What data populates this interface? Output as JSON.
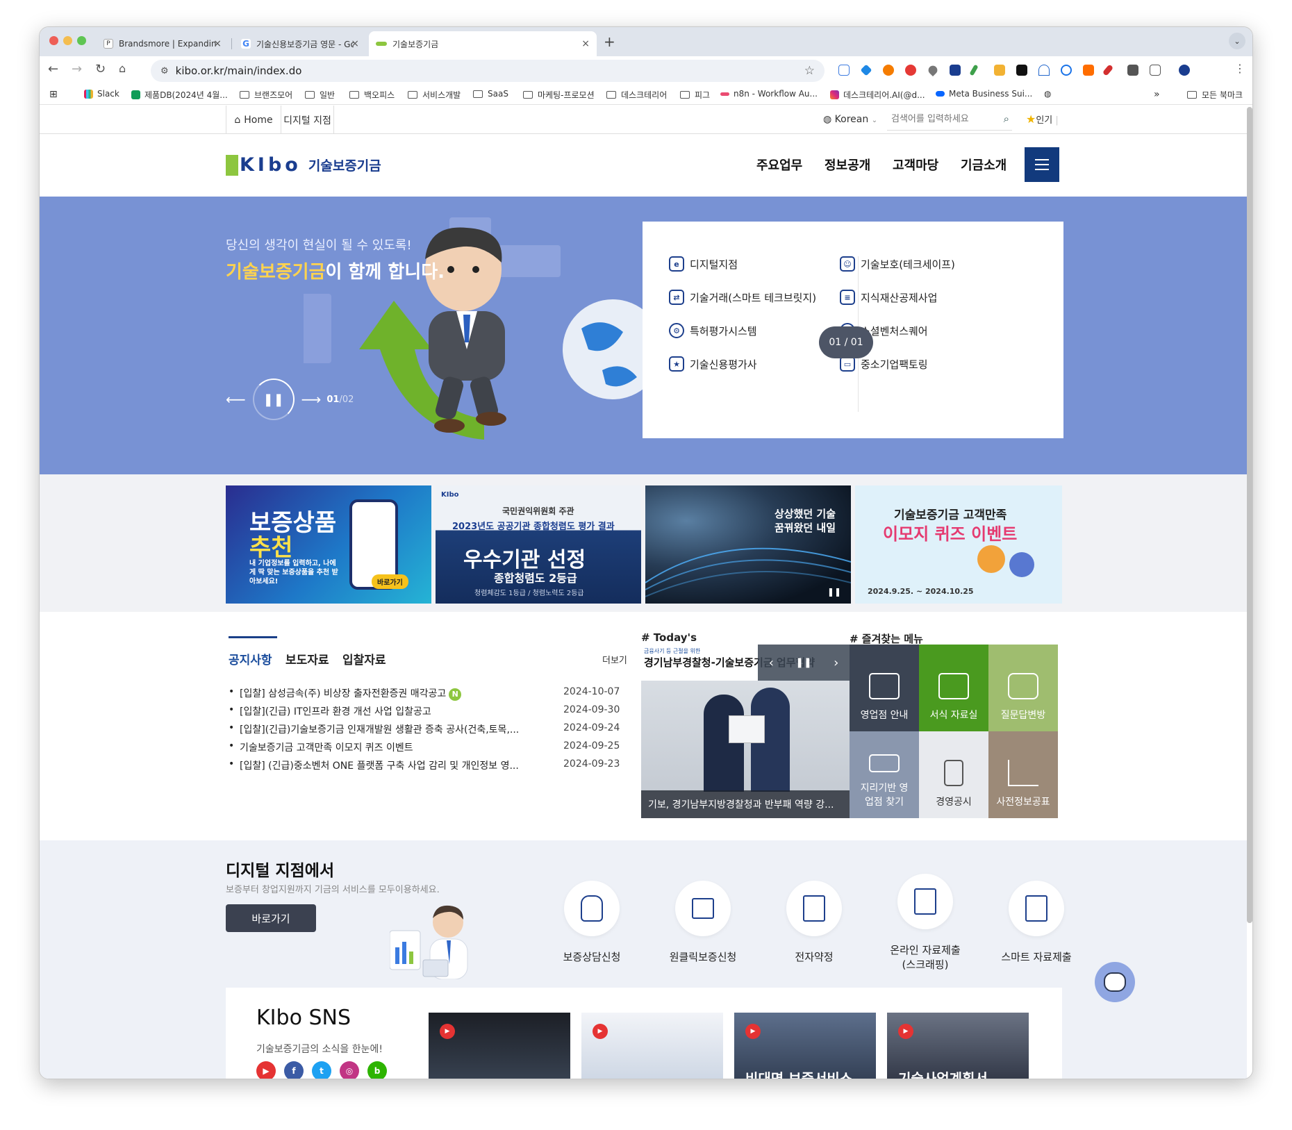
{
  "browser": {
    "tabs": [
      {
        "title": "Brandsmore | Expanding Lifes",
        "favicon": "P"
      },
      {
        "title": "기술신용보증기금 영문 - Google",
        "favicon": "G"
      },
      {
        "title": "기술보증기금",
        "favicon": ""
      }
    ],
    "url": "kibo.or.kr/main/index.do",
    "bookmarks": [
      "Slack",
      "제품DB(2024년 4월...",
      "브랜즈모어",
      "일반",
      "백오피스",
      "서비스개발",
      "SaaS",
      "마케팅-프로모션",
      "데스크테리어",
      "피그",
      "n8n - Workflow Au...",
      "데스크테리어.AI(@d...",
      "Meta Business Sui..."
    ],
    "bookmarks_more": "»",
    "all_bookmarks": "모든 북마크"
  },
  "utility": {
    "home": "Home",
    "digital": "디지털 지점",
    "language": "Korean",
    "search_placeholder": "검색어를 입력하세요",
    "popular": "인기"
  },
  "header": {
    "logo_text": "KIbo",
    "org_name": "기술보증기금",
    "nav": [
      "주요업무",
      "정보공개",
      "고객마당",
      "기금소개"
    ]
  },
  "hero": {
    "subtitle": "당신의 생각이 현실이 될 수 있도록!",
    "title_highlight": "기술보증기금",
    "title_rest": "이 함께 합니다.",
    "slide_current": "01",
    "slide_total": "/02",
    "services_left": [
      "디지털지점",
      "기술거래(스마트 테크브릿지)",
      "특허평가시스템",
      "기술신용평가사"
    ],
    "services_right": [
      "기술보호(테크세이프)",
      "지식재산공제사업",
      "소셜벤처스퀘어",
      "중소기업팩토링"
    ],
    "panel_pager": "01 / 01"
  },
  "banners": [
    {
      "title": "보증상품",
      "title2": "추천",
      "desc": "내 기업정보를 입력하고, 나에게 딱 맞는 보증상품을 추천 받아보세요!",
      "cta": "바로가기"
    },
    {
      "org": "국민권익위원회 주관",
      "line1": "2023년도 공공기관 종합청렴도 평가 결과",
      "title": "우수기관 선정",
      "line2": "종합청렴도 2등급",
      "line3": "청렴체감도 1등급 / 청렴노력도 2등급"
    },
    {
      "line1": "상상했던 기술",
      "line2": "꿈꿔왔던 내일"
    },
    {
      "title": "기술보증기금 고객만족",
      "title2": "이모지 퀴즈 이벤트",
      "period": "2024.9.25. ~ 2024.10.25"
    }
  ],
  "news": {
    "tabs": [
      "공지사항",
      "보도자료",
      "입찰자료"
    ],
    "more": "더보기",
    "items": [
      {
        "title": "[입찰] 삼성금속(주) 비상장 출자전환증권 매각공고",
        "date": "2024-10-07",
        "new": "N"
      },
      {
        "title": "[입찰](긴급) IT인프라 환경 개선 사업 입찰공고",
        "date": "2024-09-30",
        "new": ""
      },
      {
        "title": "[입찰](긴급)기술보증기금 인재개발원 생활관 증축 공사(건축,토목,...",
        "date": "2024-09-24",
        "new": ""
      },
      {
        "title": "기술보증기금 고객만족 이모지 퀴즈 이벤트",
        "date": "2024-09-25",
        "new": ""
      },
      {
        "title": "[입찰] (긴급)중소벤처 ONE 플랫폼 구축 사업 감리 및 개인정보 영...",
        "date": "2024-09-23",
        "new": ""
      }
    ]
  },
  "today": {
    "label": "# Today's",
    "head_small": "금융사기 등 근절을 위한",
    "head_big": "경기남부경찰청-기술보증기금 업무협약",
    "caption": "기보, 경기남부지방경찰청과 반부패 역량 강..."
  },
  "favorites": {
    "label": "# 즐겨찾는 메뉴",
    "tiles": [
      {
        "label": "영업점 안내",
        "color": "#3b4453"
      },
      {
        "label": "서식 자료실",
        "color": "#4a9a1f"
      },
      {
        "label": "질문답변방",
        "color": "#9fbd6f"
      },
      {
        "label": "지리기반 영업점 찾기",
        "color": "#8a97ae"
      },
      {
        "label": "경영공시",
        "color": "#e8eaee"
      },
      {
        "label": "사전정보공표",
        "color": "#9c8a78"
      }
    ]
  },
  "digital": {
    "title": "디지털 지점에서",
    "subtitle": "보증부터 창업지원까지 기금의 서비스를 모두이용하세요.",
    "button": "바로가기",
    "services": [
      "보증상담신청",
      "원클릭보증신청",
      "전자약정",
      "온라인 자료제출 (스크래핑)",
      "스마트 자료제출"
    ]
  },
  "sns": {
    "title": "KIbo SNS",
    "subtitle": "기술보증기금의 소식을 한눈에!",
    "videos": [
      "",
      "",
      "비대면 보증서비스",
      "기술사업계획서"
    ]
  }
}
